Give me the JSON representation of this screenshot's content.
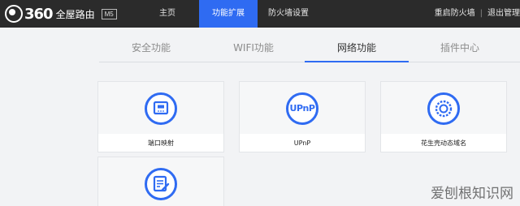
{
  "header": {
    "logo_number": "360",
    "logo_text": "全屋路由",
    "model_badge": "M5",
    "nav": {
      "home": "主页",
      "extensions": "功能扩展",
      "firewall": "防火墙设置"
    },
    "actions": {
      "restart_firewall": "重启防火墙",
      "separator": "|",
      "logout": "退出管理"
    }
  },
  "subtabs": {
    "security": "安全功能",
    "wifi": "WIFI功能",
    "network": "网络功能",
    "plugins": "插件中心"
  },
  "cards": {
    "port_mapping": {
      "label": "端口映射",
      "icon": "port-icon"
    },
    "upnp": {
      "label": "UPnP",
      "icon_text": "UPnP"
    },
    "ddns": {
      "label": "花生壳动态域名",
      "icon": "ddns-icon"
    },
    "fourth": {
      "icon": "edit-document-icon"
    }
  },
  "watermark": "爱刨根知识网",
  "colors": {
    "accent": "#2f6bf2",
    "topbar": "#2b2b2b",
    "background": "#f2f3f5"
  }
}
